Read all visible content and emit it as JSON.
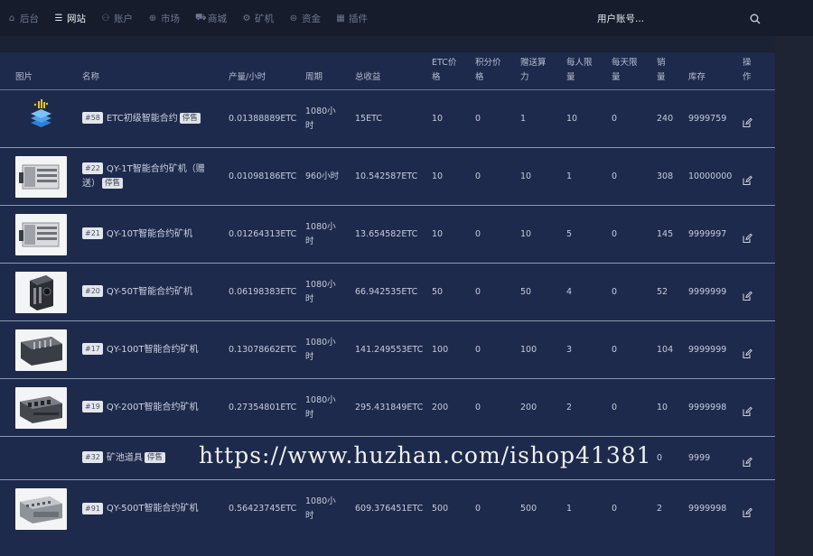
{
  "nav": {
    "items": [
      {
        "label": "后台",
        "icon": "home-icon"
      },
      {
        "label": "网站",
        "icon": "list-icon",
        "active": true
      },
      {
        "label": "账户",
        "icon": "user-icon"
      },
      {
        "label": "市场",
        "icon": "globe-icon"
      },
      {
        "label": "商城",
        "icon": "cart-icon"
      },
      {
        "label": "矿机",
        "icon": "gear-icon"
      },
      {
        "label": "资金",
        "icon": "coin-icon"
      },
      {
        "label": "插件",
        "icon": "plugin-icon"
      }
    ],
    "user": "用户账号..."
  },
  "table": {
    "headers": {
      "image": "图片",
      "name": "名称",
      "output": "产量/小时",
      "period": "周期",
      "total": "总收益",
      "etc_price": [
        "ETC价",
        "格"
      ],
      "points_price": [
        "积分价",
        "格"
      ],
      "bonus_power": [
        "赠送算",
        "力"
      ],
      "per_person_limit": [
        "每人限",
        "量"
      ],
      "per_day_limit": [
        "每天限",
        "量"
      ],
      "sales": [
        "销",
        "量"
      ],
      "stock": "库存",
      "action": [
        "操",
        "作"
      ]
    },
    "rows": [
      {
        "id": "#58",
        "name": "ETC初级智能合约",
        "tag": "停售",
        "output": "0.01388889ETC",
        "period": "1080小时",
        "total": "15ETC",
        "etc_price": "10",
        "points_price": "0",
        "bonus_power": "1",
        "per_person_limit": "10",
        "per_day_limit": "0",
        "sales": "240",
        "stock": "9999759"
      },
      {
        "id": "#22",
        "name": "QY-1T智能合约矿机（赠送）",
        "tag": "停售",
        "output": "0.01098186ETC",
        "period": "960小时",
        "total": "10.542587ETC",
        "etc_price": "10",
        "points_price": "0",
        "bonus_power": "10",
        "per_person_limit": "1",
        "per_day_limit": "0",
        "sales": "308",
        "stock": "10000000"
      },
      {
        "id": "#21",
        "name": "QY-10T智能合约矿机",
        "tag": "",
        "output": "0.01264313ETC",
        "period": "1080小时",
        "total": "13.654582ETC",
        "etc_price": "10",
        "points_price": "0",
        "bonus_power": "10",
        "per_person_limit": "5",
        "per_day_limit": "0",
        "sales": "145",
        "stock": "9999997"
      },
      {
        "id": "#20",
        "name": "QY-50T智能合约矿机",
        "tag": "",
        "output": "0.06198383ETC",
        "period": "1080小时",
        "total": "66.942535ETC",
        "etc_price": "50",
        "points_price": "0",
        "bonus_power": "50",
        "per_person_limit": "4",
        "per_day_limit": "0",
        "sales": "52",
        "stock": "9999999"
      },
      {
        "id": "#17",
        "name": "QY-100T智能合约矿机",
        "tag": "",
        "output": "0.13078662ETC",
        "period": "1080小时",
        "total": "141.249553ETC",
        "etc_price": "100",
        "points_price": "0",
        "bonus_power": "100",
        "per_person_limit": "3",
        "per_day_limit": "0",
        "sales": "104",
        "stock": "9999999"
      },
      {
        "id": "#19",
        "name": "QY-200T智能合约矿机",
        "tag": "",
        "output": "0.27354801ETC",
        "period": "1080小时",
        "total": "295.431849ETC",
        "etc_price": "200",
        "points_price": "0",
        "bonus_power": "200",
        "per_person_limit": "2",
        "per_day_limit": "0",
        "sales": "10",
        "stock": "9999998"
      },
      {
        "id": "#32",
        "name": "矿池道具",
        "tag": "停售",
        "output": "",
        "period": "",
        "total": "",
        "etc_price": "",
        "points_price": "",
        "bonus_power": "",
        "per_person_limit": "",
        "per_day_limit": "",
        "sales": "0",
        "stock": "9999"
      },
      {
        "id": "#91",
        "name": "QY-500T智能合约矿机",
        "tag": "",
        "output": "0.56423745ETC",
        "period": "1080小时",
        "total": "609.376451ETC",
        "etc_price": "500",
        "points_price": "0",
        "bonus_power": "500",
        "per_person_limit": "1",
        "per_day_limit": "0",
        "sales": "2",
        "stock": "9999998"
      }
    ]
  },
  "watermark": "https://www.huzhan.com/ishop41381",
  "colors": {
    "background": "#1b2233",
    "panel": "#1e2a4c",
    "topbar": "#161c2b"
  }
}
